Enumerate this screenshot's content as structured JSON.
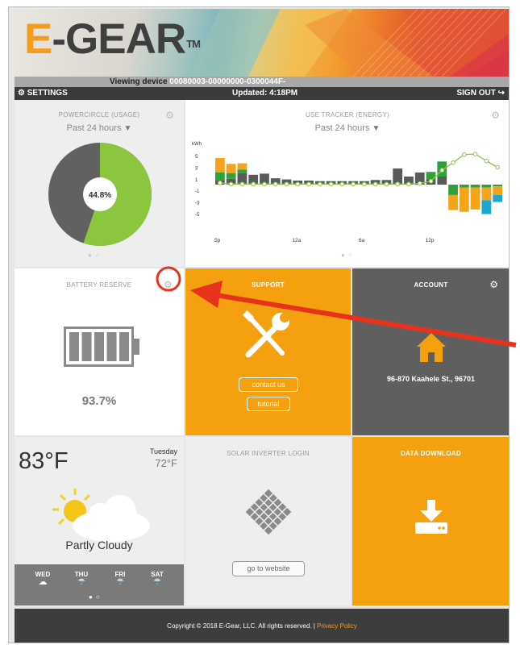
{
  "brand": {
    "logo_e": "E",
    "logo_gear": "-GEAR",
    "logo_tm": "TM"
  },
  "viewing": {
    "label": "Viewing device",
    "device_id": "00080003-00000000-0300044F-"
  },
  "topbar": {
    "settings_label": "SETTINGS",
    "updated_label": "Updated: 4:18PM",
    "signout_label": "SIGN OUT"
  },
  "powercircle": {
    "title": "POWERCIRCLE (USAGE)",
    "period": "Past 24 hours",
    "percent_label": "44.8%",
    "percent_value": 44.8,
    "colors": {
      "green": "#8cc63f",
      "gray": "#616161"
    }
  },
  "use_tracker": {
    "title": "USE TRACKER (ENERGY)",
    "period": "Past 24 hours",
    "chart_data": {
      "type": "bar",
      "ylabel": "kWh",
      "y_ticks": [
        "5",
        "3",
        "1",
        "-1",
        "-3",
        "-5"
      ],
      "x_ticks": [
        "5p",
        "12a",
        "6a",
        "12p"
      ],
      "ylim": [
        -6,
        6
      ],
      "series": [
        {
          "name": "",
          "color": "#f5a31a",
          "values": [
            2.5,
            1.6,
            1.1,
            0,
            0,
            0,
            0,
            0,
            0,
            0,
            0,
            0,
            0,
            0,
            0,
            0,
            0,
            0,
            0,
            0,
            0,
            -2.6,
            -4.2,
            -3.8,
            -2.2,
            -1.5
          ]
        },
        {
          "name": "",
          "color": "#5a5a5a",
          "values": [
            0.8,
            1.0,
            2.0,
            1.7,
            1.9,
            1.1,
            0.9,
            0.7,
            0.7,
            0.6,
            0.6,
            0.6,
            0.6,
            0.6,
            0.8,
            0.8,
            2.8,
            1.4,
            2.1,
            0.9,
            1.4,
            0,
            0,
            0,
            0,
            0
          ]
        },
        {
          "name": "",
          "color": "#2ea13a",
          "values": [
            1.3,
            1.0,
            0.6,
            0,
            0,
            0,
            0,
            0,
            0,
            0,
            0,
            0,
            0,
            0,
            0,
            0,
            0,
            0,
            0,
            1.3,
            2.6,
            -1.8,
            -0.5,
            -0.5,
            -0.5,
            -0.3
          ]
        },
        {
          "name": "",
          "color": "#1ba8cf",
          "values": [
            0,
            0,
            0,
            0,
            0,
            0,
            0,
            0,
            0,
            0,
            0,
            0,
            0,
            0,
            0,
            0,
            0,
            0,
            0,
            0,
            0,
            0,
            0,
            0,
            -2.4,
            -1.2
          ]
        },
        {
          "name": "",
          "color": "#8cc63f",
          "type": "line",
          "values": [
            0.3,
            0.1,
            0.1,
            0.1,
            0.1,
            0.1,
            0.1,
            0.1,
            0.1,
            0.1,
            0.1,
            0.1,
            0.1,
            0.1,
            0.1,
            0.1,
            0.1,
            0.1,
            0.2,
            0.6,
            2.5,
            3.8,
            5.2,
            5.3,
            4.1,
            3.0
          ]
        }
      ]
    }
  },
  "battery": {
    "title": "BATTERY RESERVE",
    "percent_label": "93.7%",
    "level": 0.937
  },
  "support": {
    "title": "SUPPORT",
    "contact_label": "contact us",
    "tutorial_label": "tutorial"
  },
  "account": {
    "title": "ACCOUNT",
    "address": "96-870 Kaahele St., 96701"
  },
  "weather": {
    "temp": "83°F",
    "day": "Tuesday",
    "low": "72°F",
    "condition": "Partly Cloudy",
    "forecast": [
      {
        "day": "WED",
        "icon": "sun-cloud-icon"
      },
      {
        "day": "THU",
        "icon": "rain-cloud-icon"
      },
      {
        "day": "FRI",
        "icon": "rain-cloud-icon"
      },
      {
        "day": "SAT",
        "icon": "rain-cloud-icon"
      }
    ]
  },
  "solar": {
    "title": "SOLAR INVERTER LOGIN",
    "button_label": "go to website"
  },
  "download": {
    "title": "DATA DOWNLOAD"
  },
  "footer": {
    "copyright": "Copyright © 2018 E-Gear, LLC. All rights reserved.",
    "separator": "|",
    "privacy_label": "Privacy Policy"
  },
  "colors": {
    "orange": "#f5a00f",
    "dark": "#3b3b3b",
    "panel_gray": "#eeeeee",
    "account_gray": "#5f5f5f"
  }
}
